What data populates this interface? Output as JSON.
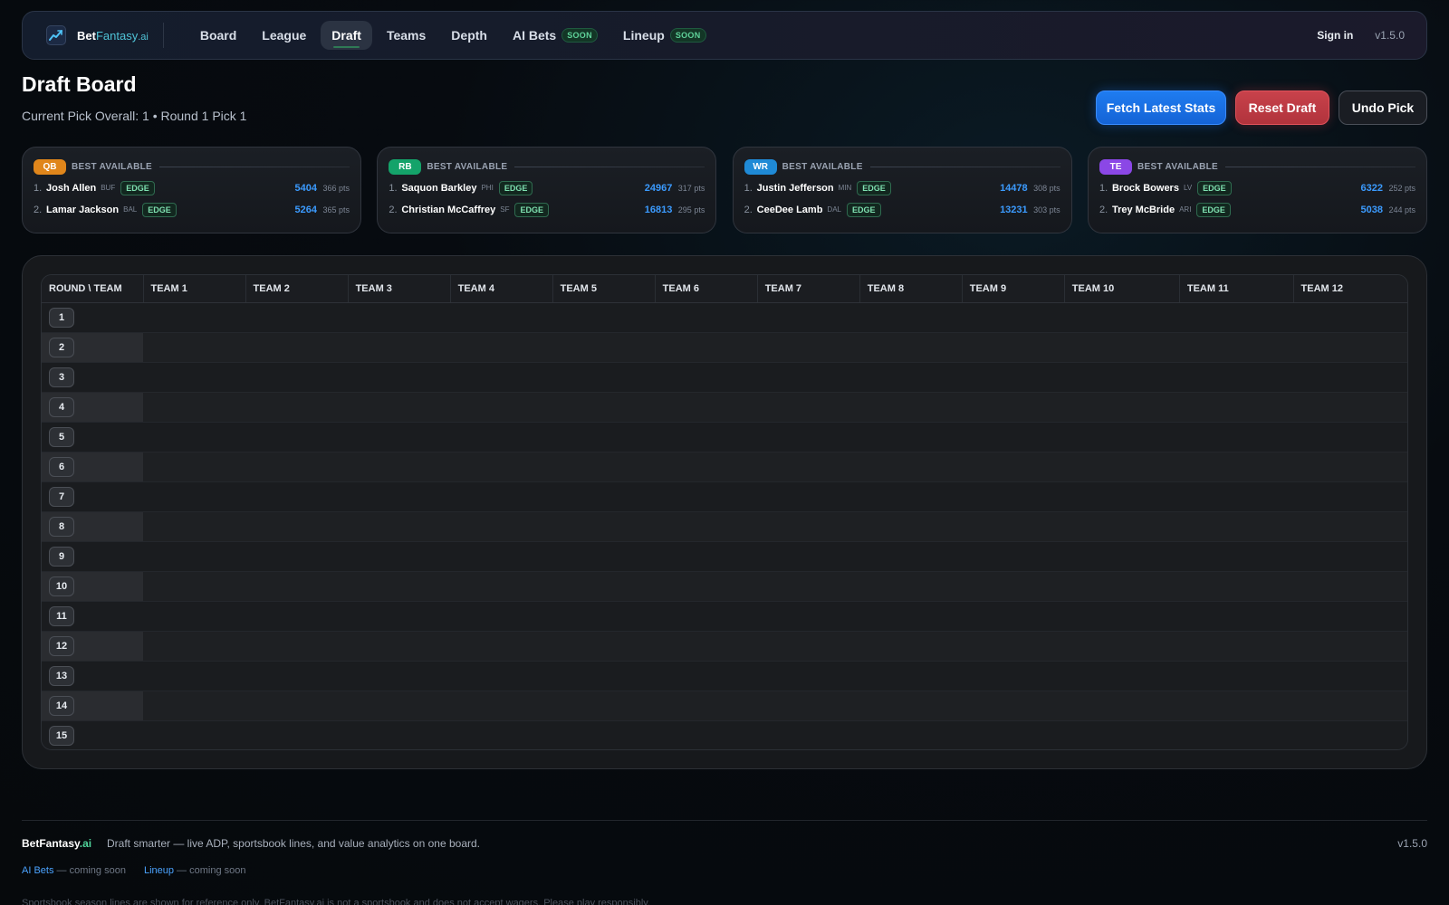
{
  "brand": {
    "name_bold": "Bet",
    "name_rest": "Fantasy",
    "suffix": ".ai"
  },
  "nav": {
    "items": [
      {
        "label": "Board"
      },
      {
        "label": "League"
      },
      {
        "label": "Draft"
      },
      {
        "label": "Teams"
      },
      {
        "label": "Depth"
      },
      {
        "label": "AI Bets",
        "badge": "SOON"
      },
      {
        "label": "Lineup",
        "badge": "SOON"
      }
    ],
    "active": "Draft",
    "signin": "Sign in",
    "version": "v1.5.0"
  },
  "header": {
    "title": "Draft Board",
    "subtitle": "Current Pick Overall: 1 • Round 1 Pick 1"
  },
  "actions": {
    "fetch": "Fetch Latest Stats",
    "reset": "Reset Draft",
    "undo": "Undo Pick"
  },
  "best_available": {
    "label": "BEST AVAILABLE",
    "cards": [
      {
        "pos": "QB",
        "color": "#e0861b",
        "players": [
          {
            "rank": "1.",
            "name": "Josh Allen",
            "team": "BUF",
            "tag": "EDGE",
            "value": "5404",
            "pts": "366 pts"
          },
          {
            "rank": "2.",
            "name": "Lamar Jackson",
            "team": "BAL",
            "tag": "EDGE",
            "value": "5264",
            "pts": "365 pts"
          }
        ]
      },
      {
        "pos": "RB",
        "color": "#14a36a",
        "players": [
          {
            "rank": "1.",
            "name": "Saquon Barkley",
            "team": "PHI",
            "tag": "EDGE",
            "value": "24967",
            "pts": "317 pts"
          },
          {
            "rank": "2.",
            "name": "Christian McCaffrey",
            "team": "SF",
            "tag": "EDGE",
            "value": "16813",
            "pts": "295 pts"
          }
        ]
      },
      {
        "pos": "WR",
        "color": "#1f8ad6",
        "players": [
          {
            "rank": "1.",
            "name": "Justin Jefferson",
            "team": "MIN",
            "tag": "EDGE",
            "value": "14478",
            "pts": "308 pts"
          },
          {
            "rank": "2.",
            "name": "CeeDee Lamb",
            "team": "DAL",
            "tag": "EDGE",
            "value": "13231",
            "pts": "303 pts"
          }
        ]
      },
      {
        "pos": "TE",
        "color": "#8b47e6",
        "players": [
          {
            "rank": "1.",
            "name": "Brock Bowers",
            "team": "LV",
            "tag": "EDGE",
            "value": "6322",
            "pts": "252 pts"
          },
          {
            "rank": "2.",
            "name": "Trey McBride",
            "team": "ARI",
            "tag": "EDGE",
            "value": "5038",
            "pts": "244 pts"
          }
        ]
      }
    ]
  },
  "board": {
    "corner_header": "ROUND \\ TEAM",
    "teams": [
      "TEAM 1",
      "TEAM 2",
      "TEAM 3",
      "TEAM 4",
      "TEAM 5",
      "TEAM 6",
      "TEAM 7",
      "TEAM 8",
      "TEAM 9",
      "TEAM 10",
      "TEAM 11",
      "TEAM 12"
    ],
    "rounds": [
      "1",
      "2",
      "3",
      "4",
      "5",
      "6",
      "7",
      "8",
      "9",
      "10",
      "11",
      "12",
      "13",
      "14",
      "15"
    ]
  },
  "footer": {
    "brand": "BetFantasy",
    "brand_suffix": ".ai",
    "tagline": "Draft smarter — live ADP, sportsbook lines, and value analytics on one board.",
    "version": "v1.5.0",
    "links": [
      {
        "label": "AI Bets",
        "note": " — coming soon"
      },
      {
        "label": "Lineup",
        "note": " — coming soon"
      }
    ],
    "disclaimer": "Sportsbook season lines are shown for reference only. BetFantasy.ai is not a sportsbook and does not accept wagers. Please play responsibly."
  }
}
